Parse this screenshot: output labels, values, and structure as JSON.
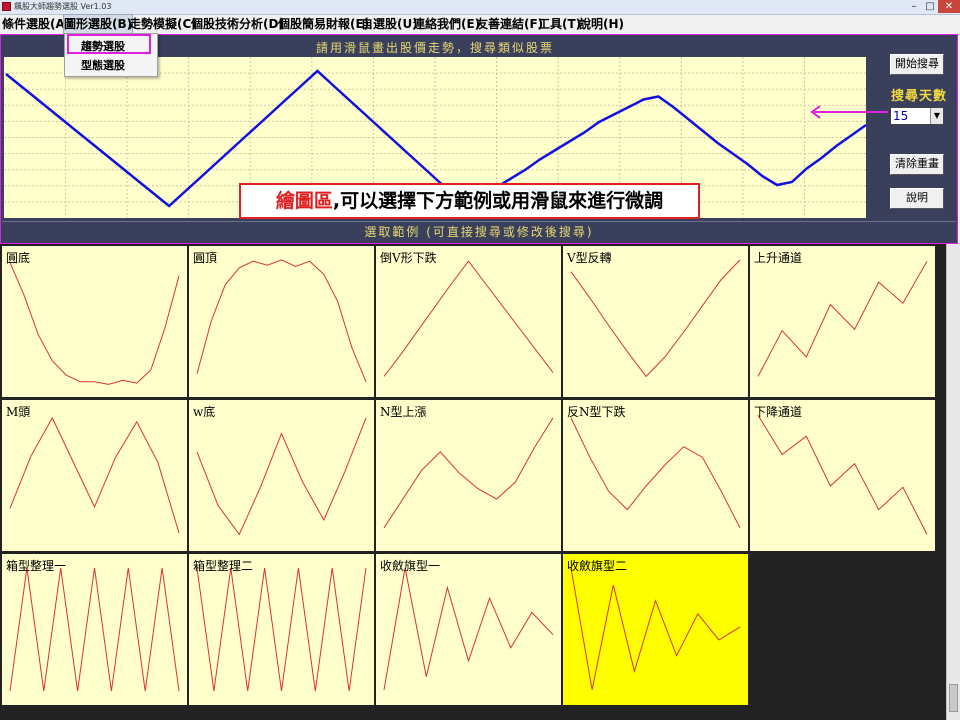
{
  "window": {
    "title": "飆股大師趨勢選股 Ver1.03",
    "min_glyph": "–",
    "max_glyph": "□",
    "close_glyph": "✕"
  },
  "menu": [
    {
      "label": "條件選股(A)"
    },
    {
      "label": "圖形選股(B)"
    },
    {
      "label": "走勢模擬(C)"
    },
    {
      "label": "個股技術分析(D)"
    },
    {
      "label": "個股簡易財報(E)"
    },
    {
      "label": "自選股(U)"
    },
    {
      "label": "連絡我們(E)"
    },
    {
      "label": "友善連結(F)"
    },
    {
      "label": "工具(T)"
    },
    {
      "label": "說明(H)"
    }
  ],
  "dropdown": {
    "items": [
      {
        "label": "趨勢選股"
      },
      {
        "label": "型態選股"
      }
    ]
  },
  "draw_panel": {
    "title": "請用滑鼠畫出股價走勢，搜尋類似股票",
    "annotation_red": "繪圖區",
    "annotation_text": ",可以選擇下方範例或用滑鼠來進行微調",
    "line_color": "#1010e0",
    "curve": [
      9.2,
      8.4,
      7.6,
      6.8,
      6.0,
      5.2,
      4.4,
      3.6,
      2.8,
      2.0,
      1.2,
      0.4,
      1.3,
      2.2,
      3.1,
      4.0,
      4.9,
      5.8,
      6.7,
      7.6,
      8.5,
      9.4,
      8.5,
      7.6,
      6.7,
      5.8,
      4.9,
      4.0,
      3.1,
      2.2,
      1.3,
      0.4,
      1.0,
      1.6,
      2.2,
      2.8,
      3.5,
      4.1,
      4.7,
      5.3,
      6.0,
      6.5,
      7.0,
      7.5,
      7.7,
      7.0,
      6.2,
      5.4,
      4.6,
      3.9,
      3.2,
      2.4,
      1.8,
      2.0,
      2.9,
      3.6,
      4.4,
      5.1,
      5.8
    ]
  },
  "controls": {
    "start_search": "開始搜尋",
    "search_days_label": "搜尋天數",
    "search_days_value": "15",
    "clear_redraw": "清除重畫",
    "help": "說明"
  },
  "examples": {
    "title": "選取範例 (可直接搜尋或修改後搜尋)",
    "line_color": "#e03030",
    "items": [
      {
        "label": "圓底",
        "values": [
          9.5,
          7.0,
          4.0,
          2.0,
          0.9,
          0.4,
          0.4,
          0.2,
          0.5,
          0.3,
          1.3,
          4.5,
          8.5
        ],
        "selected": false
      },
      {
        "label": "圓頂",
        "values": [
          1.0,
          5.0,
          7.8,
          9.1,
          9.6,
          9.3,
          9.7,
          9.2,
          9.6,
          8.6,
          6.5,
          3.0,
          0.4
        ],
        "selected": false
      },
      {
        "label": "倒V形下跌",
        "values": [
          0.8,
          2.5,
          4.3,
          6.1,
          7.9,
          9.6,
          7.9,
          6.2,
          4.5,
          2.8,
          1.1
        ],
        "selected": false
      },
      {
        "label": "V型反轉",
        "values": [
          8.8,
          6.8,
          4.7,
          2.7,
          0.8,
          2.3,
          4.2,
          6.2,
          8.2,
          9.7
        ],
        "selected": false
      },
      {
        "label": "上升通道",
        "values": [
          0.8,
          4.3,
          2.3,
          6.3,
          4.4,
          8.0,
          6.4,
          9.6
        ],
        "selected": false
      },
      {
        "label": "M頭",
        "values": [
          2.5,
          6.5,
          9.4,
          6.0,
          2.6,
          6.4,
          9.1,
          6.0,
          0.6
        ],
        "selected": false
      },
      {
        "label": "w底",
        "values": [
          6.8,
          2.7,
          0.5,
          4.1,
          8.2,
          4.5,
          1.6,
          5.3,
          9.4
        ],
        "selected": false
      },
      {
        "label": "N型上漲",
        "values": [
          1.0,
          3.2,
          5.4,
          6.8,
          5.2,
          4.0,
          3.2,
          4.5,
          7.1,
          9.4
        ],
        "selected": false
      },
      {
        "label": "反N型下跌",
        "values": [
          9.4,
          6.4,
          3.8,
          2.4,
          4.2,
          5.8,
          7.2,
          6.4,
          3.8,
          1.0
        ],
        "selected": false
      },
      {
        "label": "下降通道",
        "values": [
          9.6,
          6.6,
          8.0,
          4.2,
          5.9,
          2.4,
          4.1,
          0.5
        ],
        "selected": false
      },
      {
        "label": "箱型整理一",
        "values": [
          0.3,
          9.7,
          0.3,
          9.7,
          0.3,
          9.7,
          0.3,
          9.7,
          0.3,
          9.7,
          0.3
        ],
        "selected": false
      },
      {
        "label": "箱型整理二",
        "values": [
          9.7,
          0.3,
          9.7,
          0.3,
          9.7,
          0.3,
          9.7,
          0.3,
          9.7,
          0.3,
          9.7
        ],
        "selected": false
      },
      {
        "label": "收斂旗型一",
        "values": [
          0.4,
          9.7,
          1.4,
          8.2,
          2.6,
          7.4,
          3.6,
          6.3,
          4.6
        ],
        "selected": false
      },
      {
        "label": "收斂旗型二",
        "values": [
          9.7,
          0.4,
          8.4,
          1.8,
          7.2,
          3.0,
          6.2,
          4.2,
          5.2
        ],
        "selected": true
      }
    ]
  }
}
